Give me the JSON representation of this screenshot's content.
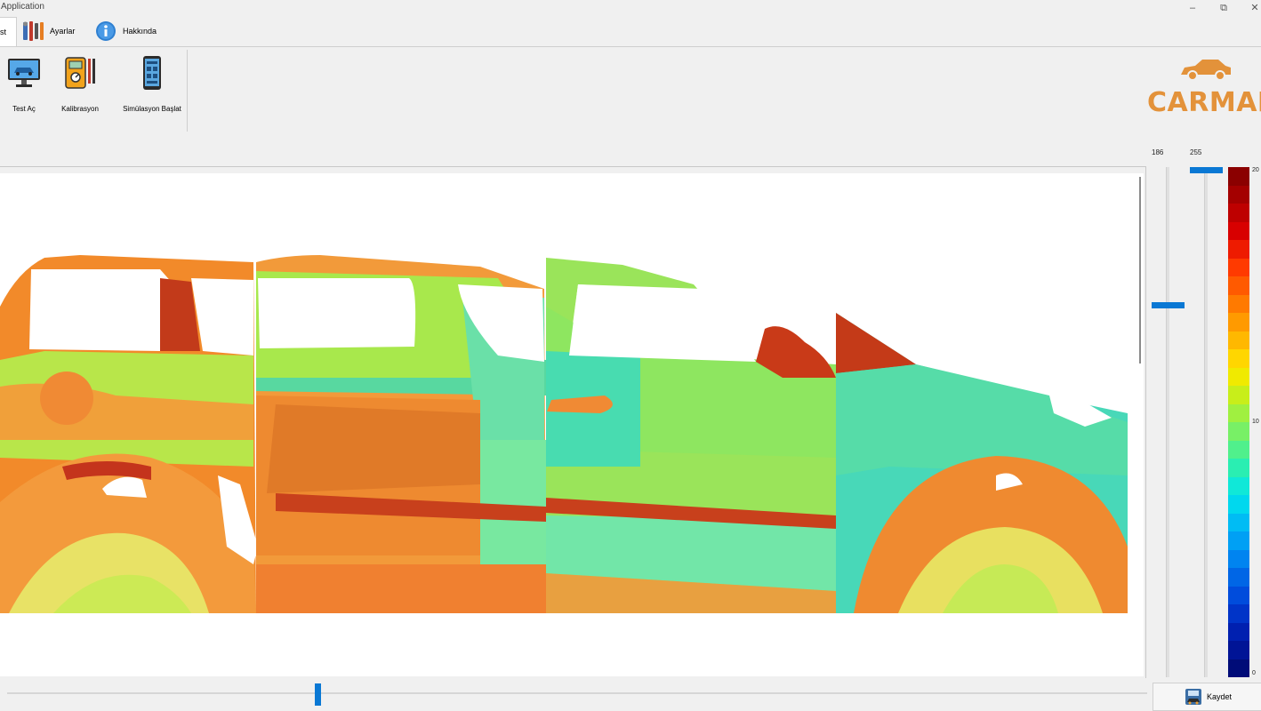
{
  "window": {
    "title": "Application",
    "minimize": "–",
    "restore": "⧉",
    "close": "✕"
  },
  "tabs": [
    {
      "label": "st",
      "active": true,
      "icon": "test-icon"
    },
    {
      "label": "Ayarlar",
      "active": false,
      "icon": "tools-icon"
    },
    {
      "label": "Hakkında",
      "active": false,
      "icon": "info-icon"
    }
  ],
  "ribbon": {
    "buttons": [
      {
        "label": "Test Aç",
        "icon": "monitor-car-icon"
      },
      {
        "label": "Kalibrasyon",
        "icon": "multimeter-icon"
      },
      {
        "label": "Simülasyon Başlat",
        "icon": "phone-app-icon"
      }
    ]
  },
  "logo": {
    "text": "CARMAP",
    "icon": "car-logo-icon"
  },
  "range": {
    "min_label": "186",
    "max_label": "255",
    "min_value": 186,
    "max_value": 255
  },
  "colorbar": {
    "top_label": "20",
    "mid_label": "10",
    "bottom_label": "0",
    "colors": [
      "#8b0000",
      "#a40000",
      "#be0000",
      "#d80000",
      "#ee1b00",
      "#ff3a00",
      "#ff5a00",
      "#ff7a00",
      "#ff9a00",
      "#ffb800",
      "#ffd600",
      "#f0ea00",
      "#c8ee1a",
      "#a0f040",
      "#78f066",
      "#50f08c",
      "#2aeeb2",
      "#10e8d8",
      "#00d8ee",
      "#00bcf4",
      "#00a0f4",
      "#0084f0",
      "#0066e6",
      "#004cdc",
      "#0034c8",
      "#0020b0",
      "#001496",
      "#000c78"
    ]
  },
  "colors": {
    "accent": "#0a78d4",
    "logo": "#e3923a"
  },
  "timeline": {
    "position": 0.27
  },
  "save": {
    "label": "Kaydet",
    "icon": "save-car-icon"
  }
}
